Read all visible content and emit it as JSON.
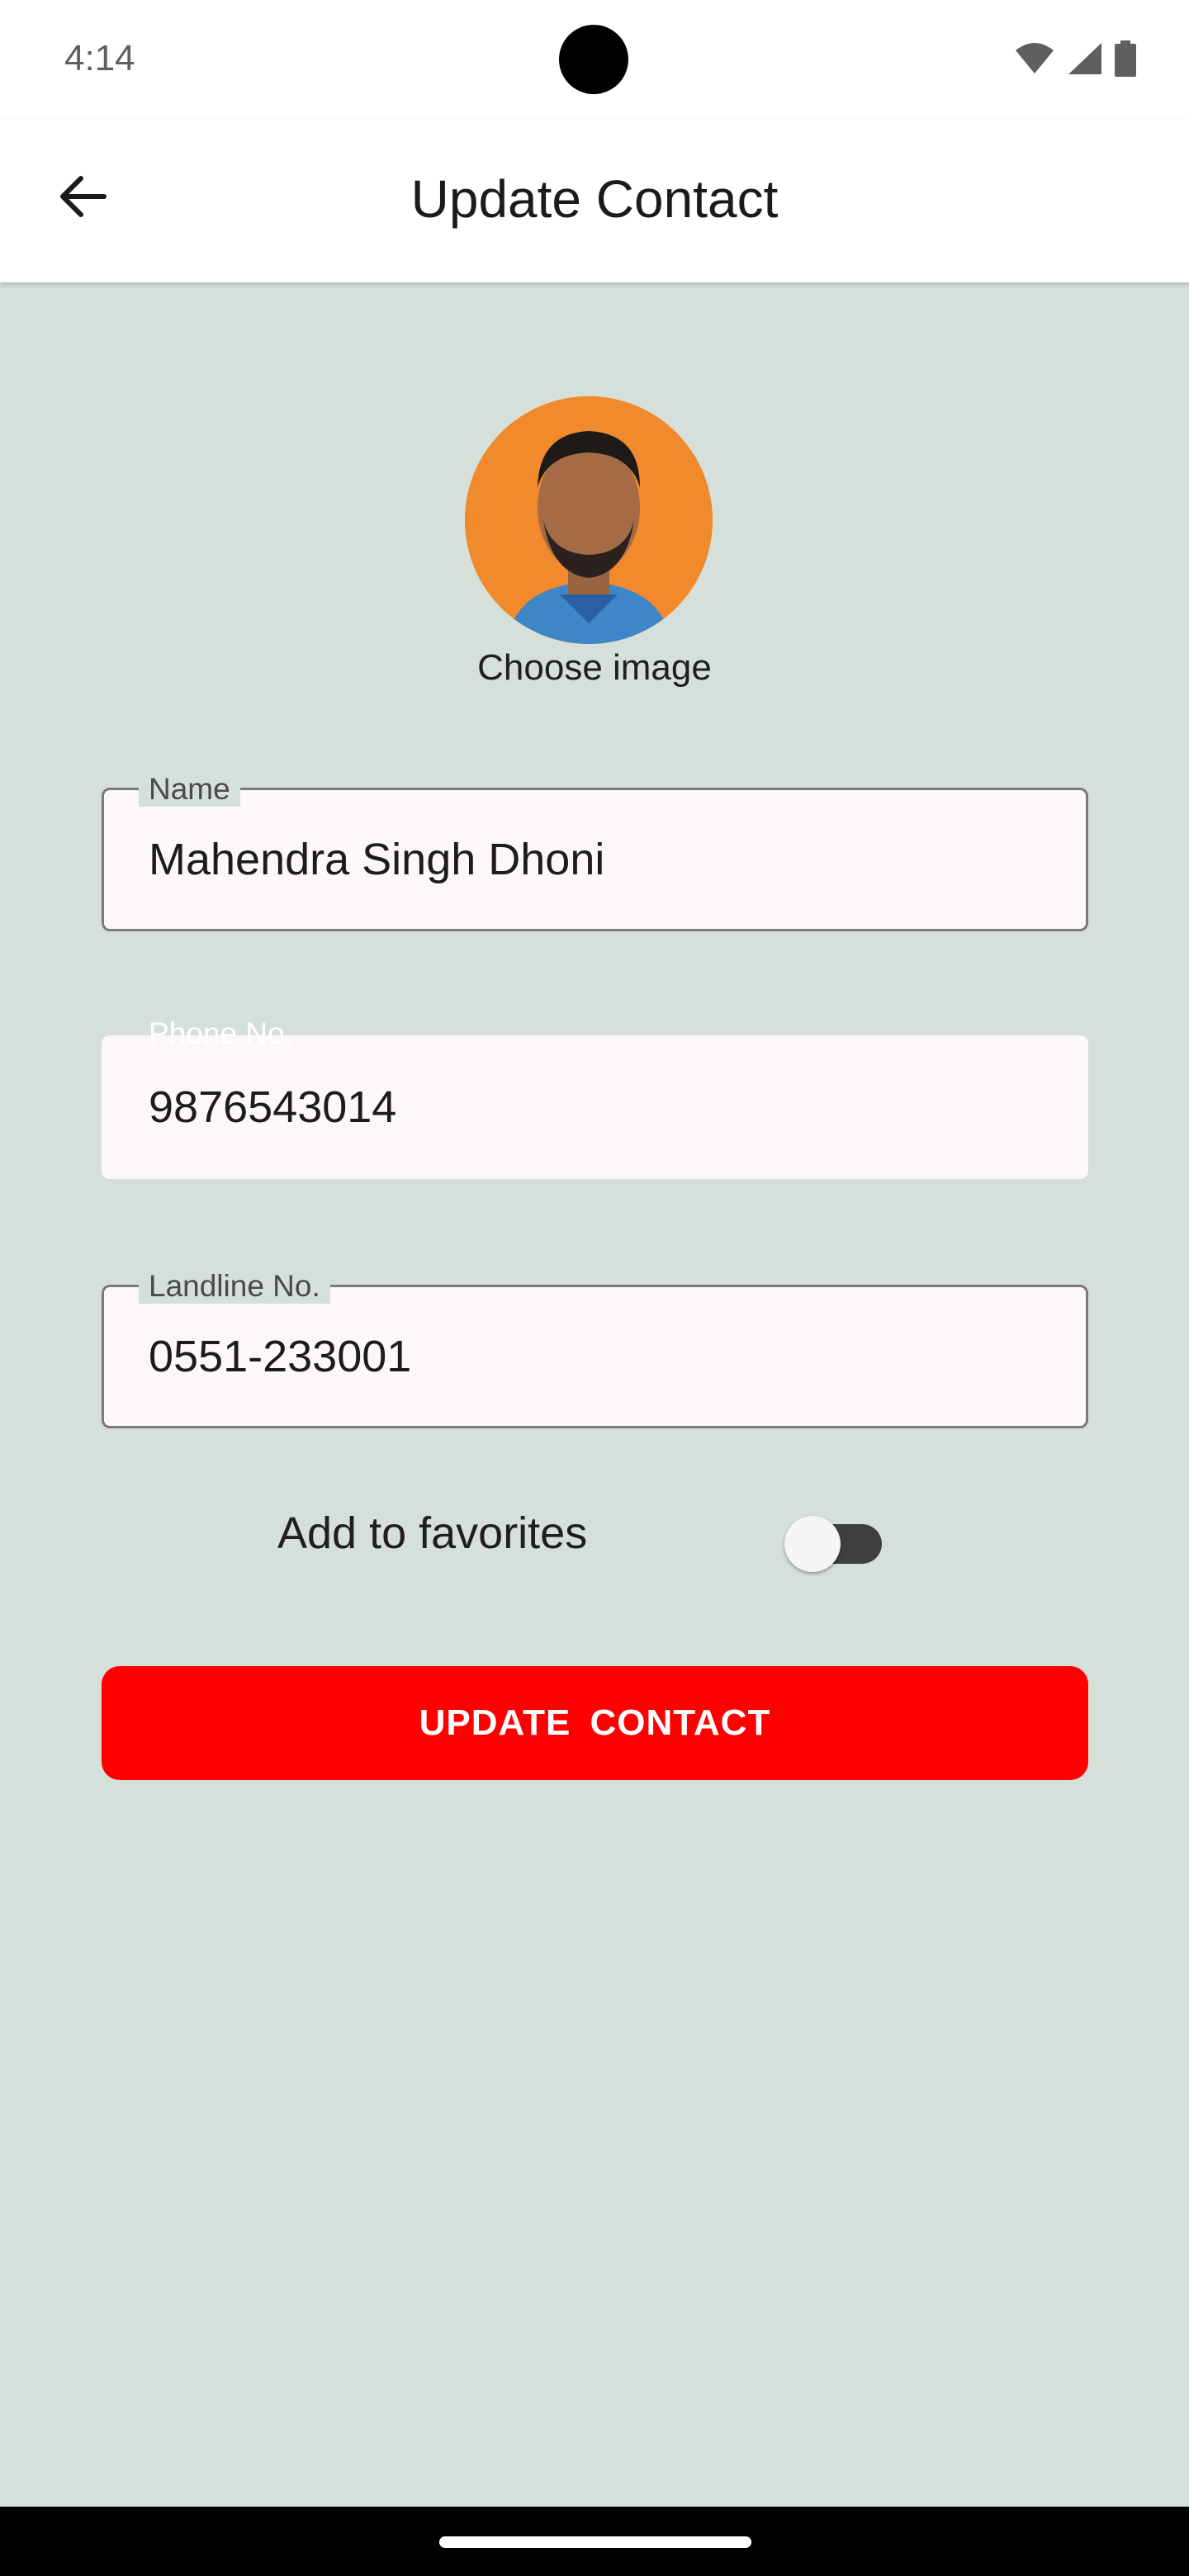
{
  "status_bar": {
    "time": "4:14"
  },
  "app_bar": {
    "title": "Update Contact"
  },
  "avatar": {
    "choose_label": "Choose image"
  },
  "form": {
    "name": {
      "label": "Name",
      "value": "Mahendra Singh Dhoni"
    },
    "phone": {
      "label": "Phone No.",
      "value": "9876543014"
    },
    "landline": {
      "label": "Landline No.",
      "value": "0551-233001"
    }
  },
  "favorites": {
    "label": "Add to favorites",
    "enabled": false
  },
  "actions": {
    "update_label": "UPDATE  CONTACT"
  },
  "colors": {
    "background": "#d6e0db",
    "primary_button": "#ff0000",
    "field_fill": "#fcf7fb"
  },
  "icons": [
    "back-arrow-icon",
    "wifi-icon",
    "signal-icon",
    "battery-icon"
  ]
}
